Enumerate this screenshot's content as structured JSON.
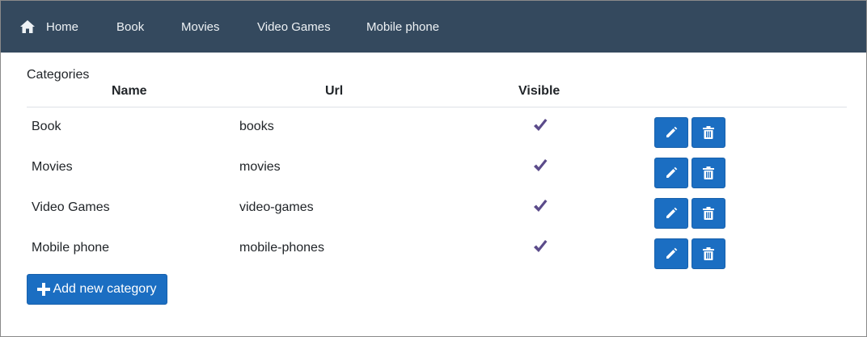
{
  "nav": {
    "home_label": "Home",
    "items": [
      {
        "label": "Book"
      },
      {
        "label": "Movies"
      },
      {
        "label": "Video Games"
      },
      {
        "label": "Mobile phone"
      }
    ]
  },
  "table": {
    "caption": "Categories",
    "headers": {
      "name": "Name",
      "url": "Url",
      "visible": "Visible"
    },
    "rows": [
      {
        "name": "Book",
        "url": "books",
        "visible": true
      },
      {
        "name": "Movies",
        "url": "movies",
        "visible": true
      },
      {
        "name": "Video Games",
        "url": "video-games",
        "visible": true
      },
      {
        "name": "Mobile phone",
        "url": "mobile-phones",
        "visible": true
      }
    ]
  },
  "actions": {
    "add_label": "Add new category"
  },
  "colors": {
    "navbar": "#34495e",
    "primary": "#1b6ec2",
    "check": "#5b4b8a"
  },
  "icons": {
    "home": "home-icon",
    "check": "check-icon",
    "edit": "pencil-icon",
    "delete": "trash-icon",
    "add": "plus-icon"
  }
}
